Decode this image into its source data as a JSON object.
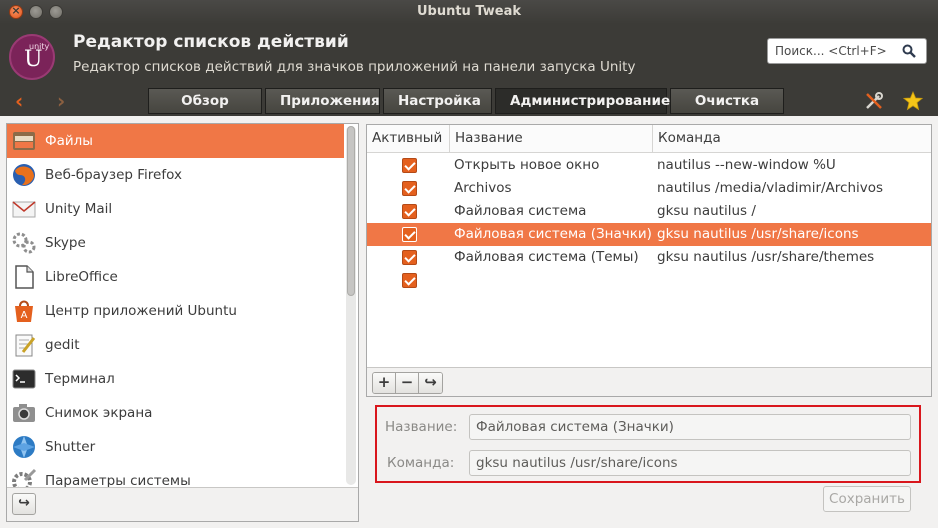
{
  "window": {
    "title": "Ubuntu Tweak"
  },
  "header": {
    "logo_text": "unity",
    "logo_letter": "U",
    "title": "Редактор списков действий",
    "subtitle": "Редактор списков действий для значков приложений на панели запуска Unity",
    "search_placeholder": "Поиск... <Ctrl+F>"
  },
  "toolbar": {
    "back": "‹",
    "forward": "›",
    "tabs": [
      {
        "label": "Обзор"
      },
      {
        "label": "Приложения"
      },
      {
        "label": "Настройка"
      },
      {
        "label": "Администрирование"
      },
      {
        "label": "Очистка"
      }
    ],
    "active_tab": "Администрирование"
  },
  "apps": [
    {
      "label": "Файлы",
      "icon": "files-icon",
      "selected": true
    },
    {
      "label": "Веб-браузер Firefox",
      "icon": "firefox-icon"
    },
    {
      "label": "Unity Mail",
      "icon": "mail-icon"
    },
    {
      "label": "Skype",
      "icon": "skype-icon"
    },
    {
      "label": "LibreOffice",
      "icon": "libreoffice-icon"
    },
    {
      "label": "Центр приложений Ubuntu",
      "icon": "software-center-icon"
    },
    {
      "label": "gedit",
      "icon": "gedit-icon"
    },
    {
      "label": "Терминал",
      "icon": "terminal-icon"
    },
    {
      "label": "Снимок экрана",
      "icon": "camera-icon"
    },
    {
      "label": "Shutter",
      "icon": "shutter-icon"
    },
    {
      "label": "Параметры системы",
      "icon": "settings-icon"
    }
  ],
  "table": {
    "columns": [
      "Активный",
      "Название",
      "Команда"
    ],
    "rows": [
      {
        "active": true,
        "name": "Открыть новое окно",
        "command": "nautilus --new-window %U"
      },
      {
        "active": true,
        "name": "Archivos",
        "command": "nautilus /media/vladimir/Archivos"
      },
      {
        "active": true,
        "name": "Файловая система",
        "command": "gksu nautilus /"
      },
      {
        "active": true,
        "name": "Файловая система (Значки)",
        "command": "gksu nautilus /usr/share/icons",
        "selected": true
      },
      {
        "active": true,
        "name": "Файловая система (Темы)",
        "command": "gksu nautilus /usr/share/themes"
      },
      {
        "active": true,
        "name": "",
        "command": ""
      }
    ],
    "tool_add": "+",
    "tool_remove": "−",
    "tool_redo": "↪"
  },
  "detail": {
    "name_label": "Название:",
    "name_value": "Файловая система (Значки)",
    "command_label": "Команда:",
    "command_value": "gksu nautilus /usr/share/icons",
    "save_label": "Сохранить"
  },
  "left_tool": "↪",
  "colors": {
    "accent": "#e4601e",
    "selection": "#f07746",
    "header": "#3c3b37",
    "highlight_box": "#d9161c"
  }
}
